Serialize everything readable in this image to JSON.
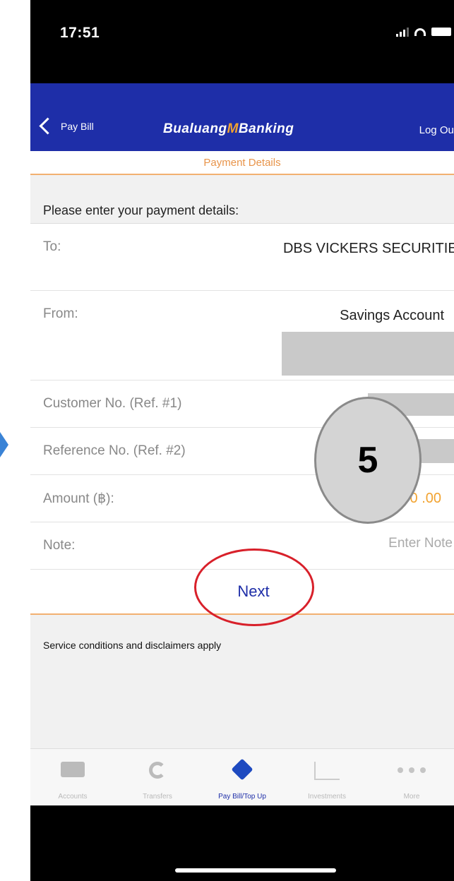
{
  "status_bar": {
    "time": "17:51"
  },
  "header": {
    "back_label": "Pay Bill",
    "logo_text": "Bualuang",
    "logo_m": "M",
    "logo_tail": "Banking",
    "logout_label": "Log Out"
  },
  "section_title": "Payment Details",
  "form": {
    "prompt": "Please enter your payment details:",
    "to_label": "To:",
    "to_value": "DBS VICKERS SECURITIES",
    "from_label": "From:",
    "from_value": "Savings Account",
    "customer_label": "Customer No. (Ref. #1)",
    "reference_label": "Reference No. (Ref. #2)",
    "amount_label": "Amount (฿):",
    "amount_value": "100 .00",
    "note_label": "Note:",
    "note_placeholder": "Enter Note",
    "next_label": "Next"
  },
  "disclaimer": "Service conditions and disclaimers apply",
  "step_badge": "5",
  "tabs": [
    {
      "label": "Accounts",
      "icon": "card-icon"
    },
    {
      "label": "Transfers",
      "icon": "transfer-icon"
    },
    {
      "label": "Pay Bill/Top Up",
      "icon": "pay-bill-icon",
      "active": true
    },
    {
      "label": "Investments",
      "icon": "chart-icon"
    },
    {
      "label": "More",
      "icon": "more-icon"
    }
  ],
  "colors": {
    "header_bg": "#1e2ea8",
    "accent_orange": "#f2a330",
    "ring_red": "#d8202a"
  }
}
